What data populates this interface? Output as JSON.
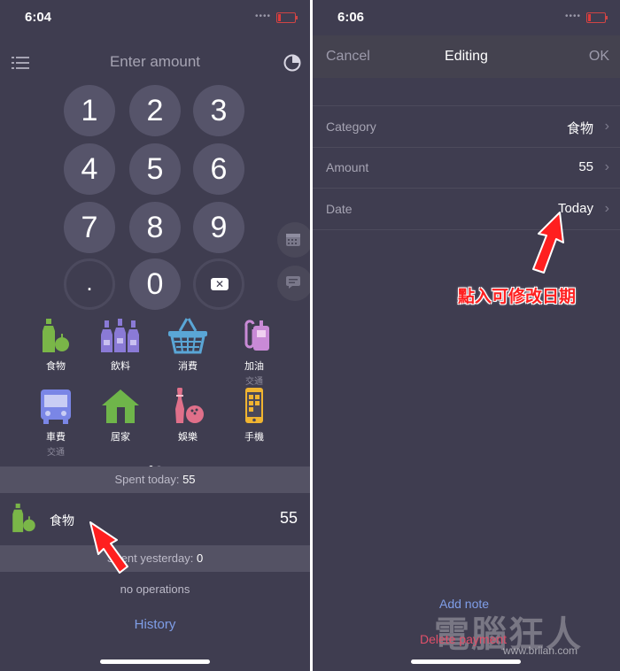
{
  "left": {
    "status": {
      "time": "6:04",
      "signal": "••••"
    },
    "header": {
      "title": "Enter amount"
    },
    "keypad": [
      "1",
      "2",
      "3",
      "4",
      "5",
      "6",
      "7",
      "8",
      "9",
      ".",
      "0"
    ],
    "categories": [
      {
        "label": "食物",
        "sub": "",
        "icon": "bottle-apple-icon"
      },
      {
        "label": "飲料",
        "sub": "",
        "icon": "bottles-icon"
      },
      {
        "label": "消費",
        "sub": "",
        "icon": "basket-icon"
      },
      {
        "label": "加油",
        "sub": "交通",
        "icon": "fuel-pump-icon"
      },
      {
        "label": "車費",
        "sub": "交通",
        "icon": "bus-icon"
      },
      {
        "label": "居家",
        "sub": "",
        "icon": "house-icon"
      },
      {
        "label": "娛樂",
        "sub": "",
        "icon": "bowling-icon"
      },
      {
        "label": "手機",
        "sub": "",
        "icon": "phone-icon"
      }
    ],
    "spent_today": {
      "label": "Spent today: ",
      "value": "55"
    },
    "operation": {
      "name": "食物",
      "amount": "55"
    },
    "spent_yesterday": {
      "label": "Spent yesterday: ",
      "value": "0"
    },
    "no_operations": "no operations",
    "history": "History"
  },
  "right": {
    "status": {
      "time": "6:06",
      "signal": "••••"
    },
    "nav": {
      "cancel": "Cancel",
      "title": "Editing",
      "ok": "OK"
    },
    "rows": [
      {
        "label": "Category",
        "value": "食物"
      },
      {
        "label": "Amount",
        "value": "55"
      },
      {
        "label": "Date",
        "value": "Today"
      }
    ],
    "annotation": "點入可修改日期",
    "add_note": "Add note",
    "delete_payment": "Delete payment",
    "watermark": "電腦狂人",
    "watermark_url": "www.briian.com"
  },
  "colors": {
    "background": "#3f3d50",
    "key": "#56546a",
    "accent_link": "#7f9ee8",
    "delete": "#e0506a",
    "annotation": "#ff1f1f",
    "food_green": "#7ab648",
    "drink_purple": "#8a7ad6",
    "basket_blue": "#5aa6d6",
    "fuel_pink": "#c98ad6",
    "bus_blue": "#7a86e6",
    "house_green": "#6fb54a",
    "bowling_pink": "#e0708a",
    "phone_yellow": "#f0b430"
  }
}
